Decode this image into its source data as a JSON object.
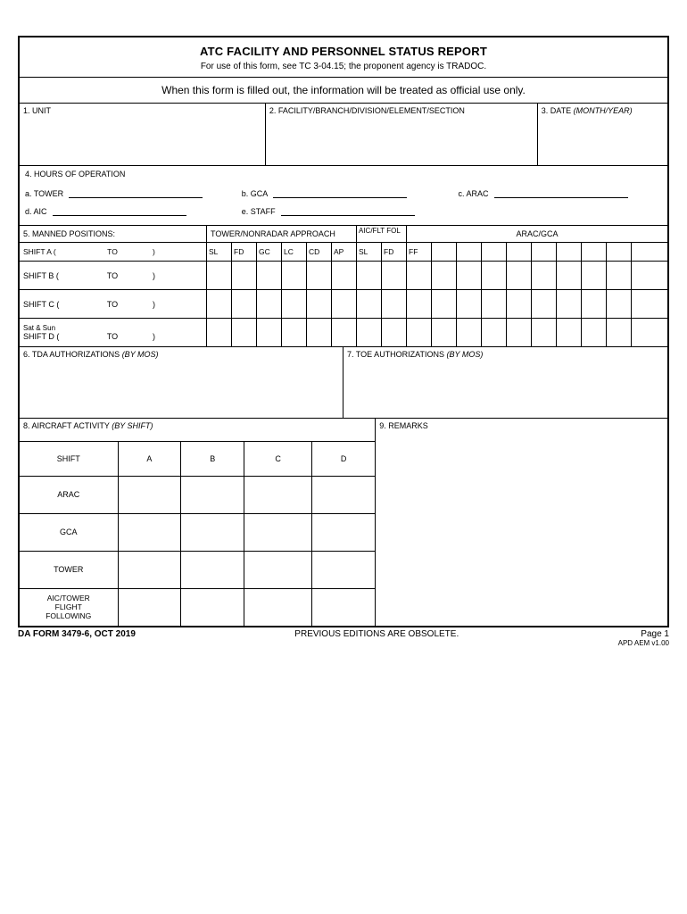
{
  "header": {
    "title": "ATC FACILITY AND PERSONNEL STATUS REPORT",
    "subtitle": "For use of this form, see TC 3-04.15; the proponent agency is TRADOC."
  },
  "notice": "When this form is filled out, the information will be treated as official use only.",
  "fields": {
    "unit": "1. UNIT",
    "facility": "2. FACILITY/BRANCH/DIVISION/ELEMENT/SECTION",
    "date": "3. DATE (MONTH/YEAR)",
    "hours": "4. HOURS OF OPERATION",
    "tower": "a. TOWER",
    "gca": "b. GCA",
    "arac": "c. ARAC",
    "aic": "d. AIC",
    "staff": "e. STAFF"
  },
  "section5": {
    "label": "5.  MANNED POSITIONS:",
    "tower_nonradar": "TOWER/NONRADAR APPROACH",
    "aicflt": "AIC/FLT FOL",
    "aracgca": "ARAC/GCA"
  },
  "gridcols": {
    "sl": "SL",
    "fd": "FD",
    "gc": "GC",
    "lc": "LC",
    "cd": "CD",
    "ap": "AP",
    "sl2": "SL",
    "fd2": "FD",
    "ff": "FF"
  },
  "shifts": {
    "a": "SHIFT A (",
    "b": "SHIFT B (",
    "c": "SHIFT C (",
    "satsun": "Sat & Sun",
    "d": "SHIFT D (",
    "to": "TO",
    "close": ")"
  },
  "s6": {
    "label": "6. TDA AUTHORIZATIONS ",
    "ital": "(BY MOS)"
  },
  "s7": {
    "label": "7. TOE AUTHORIZATIONS ",
    "ital": "(BY MOS)"
  },
  "s8": {
    "label": "8. AIRCRAFT ACTIVITY ",
    "ital": "(BY SHIFT)"
  },
  "s9": {
    "label": "9. REMARKS"
  },
  "activity": {
    "shift": "SHIFT",
    "cols": {
      "a": "A",
      "b": "B",
      "c": "C",
      "d": "D"
    },
    "rows": {
      "arac": "ARAC",
      "gca": "GCA",
      "tower": "TOWER",
      "aictower": "AIC/TOWER FLIGHT FOLLOWING"
    }
  },
  "footer": {
    "form": "DA FORM 3479-6, OCT 2019",
    "obsolete": "PREVIOUS EDITIONS ARE OBSOLETE.",
    "page": "Page 1",
    "apd": "APD AEM v1.00"
  }
}
